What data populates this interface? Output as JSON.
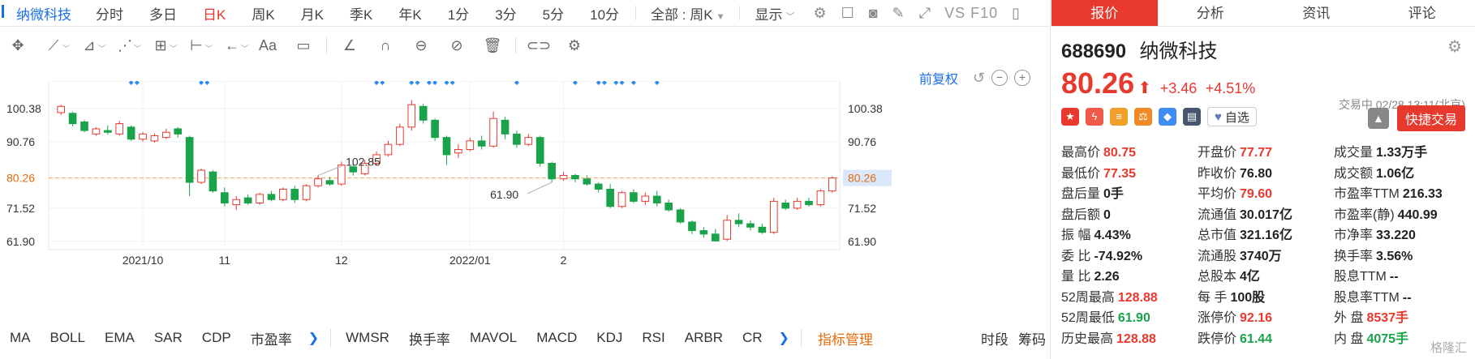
{
  "period_bar": {
    "stock_name": "纳微科技",
    "periods": [
      "分时",
      "多日",
      "日K",
      "周K",
      "月K",
      "季K",
      "年K",
      "1分",
      "3分",
      "5分",
      "10分"
    ],
    "active_period": "日K",
    "range_dropdown": "全部 : 周K",
    "display_dropdown": "显示",
    "vs_f10": "VS F10"
  },
  "draw_toolbar": {
    "aa_label": "Aa"
  },
  "restore": {
    "label": "前复权"
  },
  "chart_data": {
    "type": "candlestick",
    "y_ticks": [
      100.38,
      90.76,
      80.26,
      71.52,
      61.9
    ],
    "ylim": [
      59.5,
      106.0
    ],
    "x_ticks": [
      {
        "label": "2021/10",
        "index": 7
      },
      {
        "label": "11",
        "index": 14
      },
      {
        "label": "12",
        "index": 24
      },
      {
        "label": "2022/01",
        "index": 35
      },
      {
        "label": "2",
        "index": 43
      }
    ],
    "current_price_line": 80.26,
    "high_label": "102.85",
    "high_index": 22,
    "low_label": "61.90",
    "low_index": 42,
    "colors": {
      "up": "#e8392e",
      "down": "#1aa34a",
      "price_line": "#f5a05a",
      "marker": "#2d8cf0"
    },
    "diamond_markers_at": [
      6,
      6.5,
      12,
      12.5,
      27,
      27.5,
      30,
      30.5,
      31.5,
      32,
      33,
      33.5,
      39,
      44,
      46,
      46.5,
      47.5,
      48,
      49,
      51
    ],
    "candles": [
      {
        "o": 99.2,
        "c": 101.0,
        "h": 101.5,
        "l": 98.5
      },
      {
        "o": 99.0,
        "c": 96.0,
        "h": 99.5,
        "l": 95.2
      },
      {
        "o": 96.5,
        "c": 94.0,
        "h": 97.0,
        "l": 93.5
      },
      {
        "o": 93.0,
        "c": 94.5,
        "h": 95.0,
        "l": 92.5
      },
      {
        "o": 94.0,
        "c": 93.5,
        "h": 95.5,
        "l": 92.8
      },
      {
        "o": 93.0,
        "c": 96.0,
        "h": 96.8,
        "l": 92.5
      },
      {
        "o": 95.0,
        "c": 91.5,
        "h": 95.5,
        "l": 91.0
      },
      {
        "o": 91.5,
        "c": 93.0,
        "h": 93.5,
        "l": 90.8
      },
      {
        "o": 91.0,
        "c": 92.5,
        "h": 93.2,
        "l": 90.5
      },
      {
        "o": 92.0,
        "c": 93.5,
        "h": 94.5,
        "l": 91.5
      },
      {
        "o": 94.5,
        "c": 93.0,
        "h": 95.0,
        "l": 92.0
      },
      {
        "o": 92.0,
        "c": 79.0,
        "h": 92.5,
        "l": 75.0
      },
      {
        "o": 79.0,
        "c": 82.5,
        "h": 83.0,
        "l": 78.5
      },
      {
        "o": 82.0,
        "c": 76.5,
        "h": 82.5,
        "l": 76.0
      },
      {
        "o": 76.0,
        "c": 73.0,
        "h": 77.5,
        "l": 72.0
      },
      {
        "o": 72.5,
        "c": 74.0,
        "h": 75.0,
        "l": 71.0
      },
      {
        "o": 74.5,
        "c": 73.0,
        "h": 75.5,
        "l": 72.5
      },
      {
        "o": 73.0,
        "c": 75.5,
        "h": 76.0,
        "l": 72.5
      },
      {
        "o": 75.5,
        "c": 74.0,
        "h": 76.5,
        "l": 73.5
      },
      {
        "o": 74.0,
        "c": 77.0,
        "h": 77.5,
        "l": 73.5
      },
      {
        "o": 77.0,
        "c": 74.0,
        "h": 78.0,
        "l": 73.0
      },
      {
        "o": 74.0,
        "c": 78.0,
        "h": 78.5,
        "l": 73.5
      },
      {
        "o": 78.0,
        "c": 80.0,
        "h": 81.0,
        "l": 77.5
      },
      {
        "o": 79.5,
        "c": 78.5,
        "h": 80.5,
        "l": 78.0
      },
      {
        "o": 78.5,
        "c": 84.0,
        "h": 85.0,
        "l": 78.0
      },
      {
        "o": 83.5,
        "c": 82.0,
        "h": 84.5,
        "l": 81.0
      },
      {
        "o": 81.5,
        "c": 84.5,
        "h": 85.5,
        "l": 81.0
      },
      {
        "o": 84.5,
        "c": 87.0,
        "h": 88.0,
        "l": 84.0
      },
      {
        "o": 87.0,
        "c": 90.0,
        "h": 91.0,
        "l": 86.5
      },
      {
        "o": 90.0,
        "c": 95.0,
        "h": 96.0,
        "l": 89.5
      },
      {
        "o": 95.0,
        "c": 101.5,
        "h": 102.85,
        "l": 94.0
      },
      {
        "o": 101.0,
        "c": 97.0,
        "h": 101.8,
        "l": 96.0
      },
      {
        "o": 97.0,
        "c": 92.0,
        "h": 97.5,
        "l": 91.0
      },
      {
        "o": 92.0,
        "c": 87.0,
        "h": 92.5,
        "l": 84.0
      },
      {
        "o": 87.5,
        "c": 88.5,
        "h": 90.0,
        "l": 86.0
      },
      {
        "o": 88.5,
        "c": 91.0,
        "h": 92.0,
        "l": 88.0
      },
      {
        "o": 91.0,
        "c": 89.5,
        "h": 92.5,
        "l": 88.5
      },
      {
        "o": 89.5,
        "c": 97.5,
        "h": 99.5,
        "l": 89.0
      },
      {
        "o": 97.0,
        "c": 93.0,
        "h": 98.0,
        "l": 91.5
      },
      {
        "o": 93.0,
        "c": 90.0,
        "h": 94.0,
        "l": 89.0
      },
      {
        "o": 90.0,
        "c": 92.0,
        "h": 93.0,
        "l": 89.5
      },
      {
        "o": 92.0,
        "c": 84.5,
        "h": 92.5,
        "l": 83.5
      },
      {
        "o": 84.5,
        "c": 80.0,
        "h": 85.0,
        "l": 79.0
      },
      {
        "o": 80.0,
        "c": 81.0,
        "h": 82.0,
        "l": 79.5
      },
      {
        "o": 81.0,
        "c": 80.0,
        "h": 81.5,
        "l": 79.0
      },
      {
        "o": 80.0,
        "c": 78.5,
        "h": 81.0,
        "l": 78.0
      },
      {
        "o": 78.5,
        "c": 77.0,
        "h": 79.0,
        "l": 76.0
      },
      {
        "o": 77.0,
        "c": 72.0,
        "h": 78.5,
        "l": 71.5
      },
      {
        "o": 72.0,
        "c": 76.0,
        "h": 76.5,
        "l": 71.5
      },
      {
        "o": 76.0,
        "c": 73.5,
        "h": 77.0,
        "l": 73.0
      },
      {
        "o": 73.5,
        "c": 75.0,
        "h": 76.0,
        "l": 72.5
      },
      {
        "o": 75.0,
        "c": 73.0,
        "h": 76.5,
        "l": 72.0
      },
      {
        "o": 73.0,
        "c": 71.0,
        "h": 74.0,
        "l": 70.5
      },
      {
        "o": 71.0,
        "c": 67.5,
        "h": 71.5,
        "l": 67.0
      },
      {
        "o": 67.5,
        "c": 65.0,
        "h": 68.0,
        "l": 64.0
      },
      {
        "o": 65.0,
        "c": 64.0,
        "h": 66.0,
        "l": 63.0
      },
      {
        "o": 64.0,
        "c": 62.0,
        "h": 65.5,
        "l": 61.9
      },
      {
        "o": 62.5,
        "c": 68.0,
        "h": 69.5,
        "l": 62.0
      },
      {
        "o": 68.0,
        "c": 67.0,
        "h": 70.0,
        "l": 66.0
      },
      {
        "o": 67.0,
        "c": 66.0,
        "h": 68.0,
        "l": 65.0
      },
      {
        "o": 66.0,
        "c": 64.5,
        "h": 67.0,
        "l": 64.0
      },
      {
        "o": 64.5,
        "c": 73.5,
        "h": 74.5,
        "l": 64.0
      },
      {
        "o": 73.0,
        "c": 71.5,
        "h": 74.0,
        "l": 71.0
      },
      {
        "o": 71.5,
        "c": 73.5,
        "h": 74.5,
        "l": 71.0
      },
      {
        "o": 73.5,
        "c": 72.5,
        "h": 74.5,
        "l": 72.0
      },
      {
        "o": 72.5,
        "c": 76.5,
        "h": 77.0,
        "l": 72.0
      },
      {
        "o": 76.5,
        "c": 80.26,
        "h": 80.75,
        "l": 76.0
      }
    ]
  },
  "indicator_bar": {
    "items_a": [
      "MA",
      "BOLL",
      "EMA",
      "SAR",
      "CDP",
      "市盈率"
    ],
    "items_b": [
      "WMSR",
      "换手率",
      "MAVOL",
      "MACD",
      "KDJ",
      "RSI",
      "ARBR",
      "CR"
    ],
    "manager": "指标管理",
    "time_label": "时段",
    "chip_label": "筹码"
  },
  "quote": {
    "tabs": [
      "报价",
      "分析",
      "资讯",
      "评论"
    ],
    "code": "688690",
    "name": "纳微科技",
    "price": "80.26",
    "change": "+3.46",
    "change_pct": "+4.51%",
    "status": "交易中 02/28 13:11(北京)",
    "watch_label": "自选",
    "fast_trade": "快捷交易",
    "rows": [
      [
        {
          "l": "最高价",
          "v": "80.75",
          "c": "up"
        },
        {
          "l": "开盘价",
          "v": "77.77",
          "c": "up"
        },
        {
          "l": "成交量",
          "v": "1.33万手",
          "c": ""
        }
      ],
      [
        {
          "l": "最低价",
          "v": "77.35",
          "c": "up"
        },
        {
          "l": "昨收价",
          "v": "76.80",
          "c": ""
        },
        {
          "l": "成交额",
          "v": "1.06亿",
          "c": ""
        }
      ],
      [
        {
          "l": "盘后量",
          "v": "0手",
          "c": ""
        },
        {
          "l": "平均价",
          "v": "79.60",
          "c": "up"
        },
        {
          "l": "市盈率TTM",
          "v": "216.33",
          "c": ""
        }
      ],
      [
        {
          "l": "盘后额",
          "v": "0",
          "c": ""
        },
        {
          "l": "流通值",
          "v": "30.017亿",
          "c": ""
        },
        {
          "l": "市盈率(静)",
          "v": "440.99",
          "c": ""
        }
      ],
      [
        {
          "l": "振 幅",
          "v": "4.43%",
          "c": ""
        },
        {
          "l": "总市值",
          "v": "321.16亿",
          "c": ""
        },
        {
          "l": "市净率",
          "v": "33.220",
          "c": ""
        }
      ],
      [
        {
          "l": "委 比",
          "v": "-74.92%",
          "c": ""
        },
        {
          "l": "流通股",
          "v": "3740万",
          "c": ""
        },
        {
          "l": "换手率",
          "v": "3.56%",
          "c": ""
        }
      ],
      [
        {
          "l": "量 比",
          "v": "2.26",
          "c": ""
        },
        {
          "l": "总股本",
          "v": "4亿",
          "c": ""
        },
        {
          "l": "股息TTM",
          "v": "--",
          "c": ""
        }
      ],
      [
        {
          "l": "52周最高",
          "v": "128.88",
          "c": "up"
        },
        {
          "l": "每 手",
          "v": "100股",
          "c": ""
        },
        {
          "l": "股息率TTM",
          "v": "--",
          "c": ""
        }
      ],
      [
        {
          "l": "52周最低",
          "v": "61.90",
          "c": "down"
        },
        {
          "l": "涨停价",
          "v": "92.16",
          "c": "up"
        },
        {
          "l": "外 盘",
          "v": "8537手",
          "c": "up"
        }
      ],
      [
        {
          "l": "历史最高",
          "v": "128.88",
          "c": "up"
        },
        {
          "l": "跌停价",
          "v": "61.44",
          "c": "down"
        },
        {
          "l": "内 盘",
          "v": "4075手",
          "c": "down"
        }
      ]
    ],
    "watermark": "格隆汇"
  }
}
